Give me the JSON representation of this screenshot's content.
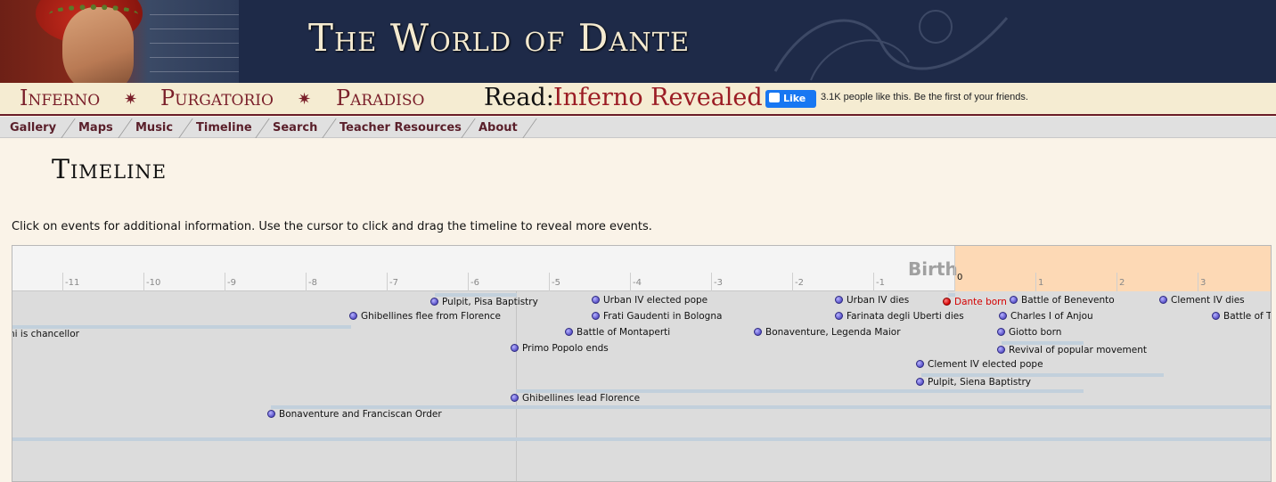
{
  "header": {
    "site_title": "The World of Dante"
  },
  "section_nav": {
    "items": [
      {
        "label": "Inferno"
      },
      {
        "label": "Purgatorio"
      },
      {
        "label": "Paradiso"
      }
    ],
    "separator": "✷",
    "read_label": "Read:",
    "read_link": "Inferno Revealed",
    "like_button": "Like",
    "like_text": "3.1K people like this. Be the first of your friends."
  },
  "sub_nav": {
    "items": [
      {
        "label": "Gallery"
      },
      {
        "label": "Maps"
      },
      {
        "label": "Music"
      },
      {
        "label": "Timeline"
      },
      {
        "label": "Search"
      },
      {
        "label": "Teacher Resources"
      },
      {
        "label": "About"
      }
    ]
  },
  "page": {
    "title": "Timeline",
    "instructions": "Click on events for additional information. Use the cursor to click and drag the timeline to reveal more events."
  },
  "timeline": {
    "band_label": "Birth",
    "ticks": [
      "-11",
      "-10",
      "-9",
      "-8",
      "-7",
      "-6",
      "-5",
      "-4",
      "-3",
      "-2",
      "-1",
      "0",
      "1",
      "2",
      "3"
    ],
    "events": [
      {
        "label": "Pulpit, Pisa Baptistry"
      },
      {
        "label": "Ghibellines flee from Florence"
      },
      {
        "label": "ni is chancellor"
      },
      {
        "label": "Primo Popolo ends"
      },
      {
        "label": "Ghibellines lead Florence"
      },
      {
        "label": "Bonaventure and Franciscan Order"
      },
      {
        "label": "Urban IV elected pope"
      },
      {
        "label": "Frati Gaudenti in Bologna"
      },
      {
        "label": "Battle of Montaperti"
      },
      {
        "label": "Bonaventure, Legenda Maior"
      },
      {
        "label": "Urban IV dies"
      },
      {
        "label": "Farinata degli Uberti dies"
      },
      {
        "label": "Dante born",
        "highlight": true
      },
      {
        "label": "Battle of Benevento"
      },
      {
        "label": "Charles I of Anjou"
      },
      {
        "label": "Giotto born"
      },
      {
        "label": "Revival of popular movement"
      },
      {
        "label": "Clement IV elected pope"
      },
      {
        "label": "Pulpit, Siena Baptistry"
      },
      {
        "label": "Clement IV dies"
      },
      {
        "label": "Battle of Ta"
      }
    ]
  },
  "colors": {
    "header_bg": "#1e2a48",
    "accent": "#7a1f2a",
    "birth_zone": "#fdd9b5",
    "highlight_event": "#d40000"
  }
}
